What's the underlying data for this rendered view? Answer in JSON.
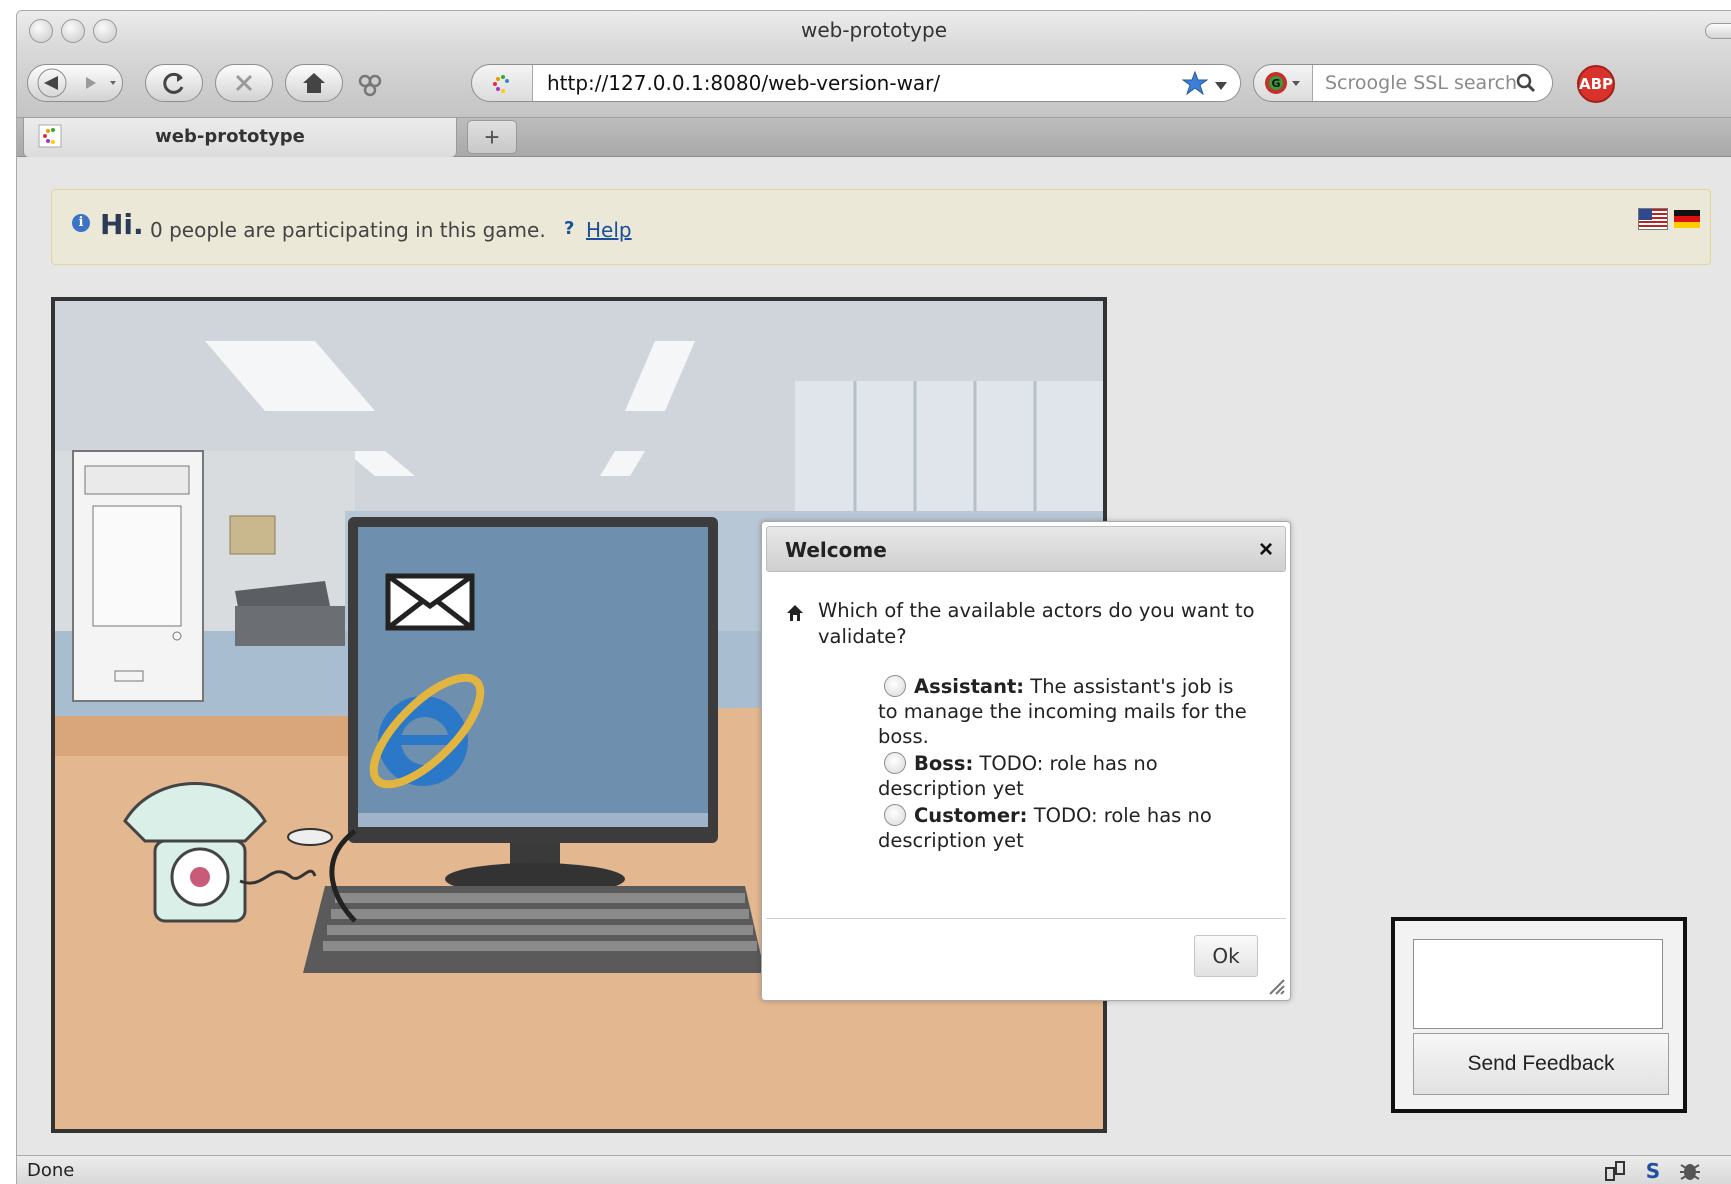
{
  "window": {
    "title": "web-prototype"
  },
  "toolbar": {
    "url": "http://127.0.0.1:8080/web-version-war/",
    "search_placeholder": "Scroogle SSL search",
    "abp_label": "ABP"
  },
  "tabs": [
    {
      "label": "web-prototype"
    }
  ],
  "newtab_label": "+",
  "notice": {
    "greeting": "Hi.",
    "participants": "0 people are participating in this game.",
    "help_icon": "?",
    "help_link": "Help"
  },
  "dialog": {
    "title": "Welcome",
    "close": "×",
    "question": "Which of the available actors do you want to validate?",
    "options": [
      {
        "name": "Assistant:",
        "description": "The assistant's job is to manage the incoming mails for the boss."
      },
      {
        "name": "Boss:",
        "description": "TODO: role has no description yet"
      },
      {
        "name": "Customer:",
        "description": "TODO: role has no description yet"
      }
    ],
    "ok_label": "Ok"
  },
  "feedback": {
    "button_label": "Send Feedback"
  },
  "statusbar": {
    "text": "Done"
  },
  "colors": {
    "info": "#3b74c5",
    "link": "#1a4f9c",
    "notice_bg": "#ebe8d7",
    "screen_blue": "#6e8fae"
  }
}
